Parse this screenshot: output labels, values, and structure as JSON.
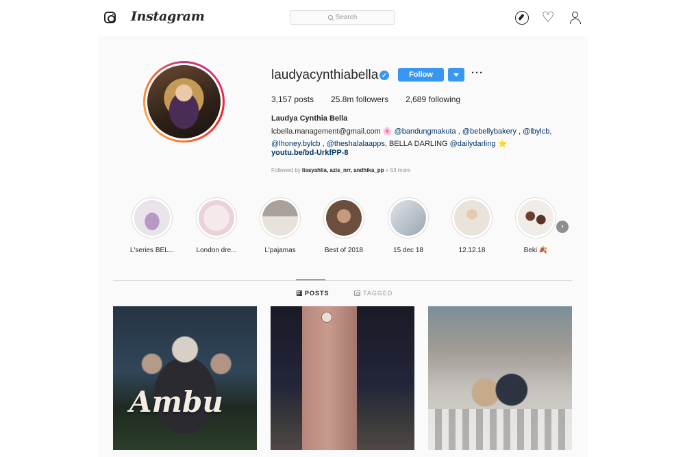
{
  "header": {
    "brand": "Instagram",
    "search_placeholder": "Search",
    "icons": [
      "instagram-icon",
      "compass-icon",
      "heart-icon",
      "profile-icon"
    ]
  },
  "profile": {
    "username": "laudyacynthiabella",
    "verified": true,
    "follow_label": "Follow",
    "more_label": "···",
    "stats": {
      "posts": "3,157 posts",
      "followers": "25.8m followers",
      "following": "2,689 following"
    },
    "full_name": "Laudya Cynthia Bella",
    "bio": {
      "line1_text": "lcbella.management@gmail.com",
      "line1_mentions": [
        "@bandungmakuta",
        ",",
        "@bebellybakery",
        ",",
        "@lbylcb,"
      ],
      "line2_mentions": [
        "@lhoney.bylcb",
        ",",
        "@theshalalaapps"
      ],
      "line2_text": ", BELLA DARLING",
      "line2_mention_end": "@dailydarling",
      "link": "youtu.be/bd-UrkfPP-8"
    },
    "followed_by": {
      "prefix": "Followed by",
      "names": "liasyahlia, azis_nrr, andhika_pp",
      "suffix": "+ 53 more"
    }
  },
  "highlights": [
    {
      "label": "L'series BEL...",
      "color": "#d9c6e0"
    },
    {
      "label": "London dre...",
      "color": "#f1dfe3"
    },
    {
      "label": "L'pajamas",
      "color": "#c9c2ba"
    },
    {
      "label": "Best of 2018",
      "color": "#8a6a55"
    },
    {
      "label": "15 dec 18",
      "color": "#cfd6dc"
    },
    {
      "label": "12.12.18",
      "color": "#e6ddd4"
    },
    {
      "label": "Beki 🍂",
      "color": "#7a5444"
    }
  ],
  "tabs": {
    "posts": "POSTS",
    "tagged": "TAGGED"
  },
  "posts": [
    {
      "overlay_text": "Ambu"
    },
    {
      "overlay_text": ""
    },
    {
      "overlay_text": ""
    }
  ],
  "colors": {
    "accent": "#3897f0",
    "link": "#003569",
    "border": "#dbdbdb",
    "muted": "#8e8e8e"
  }
}
